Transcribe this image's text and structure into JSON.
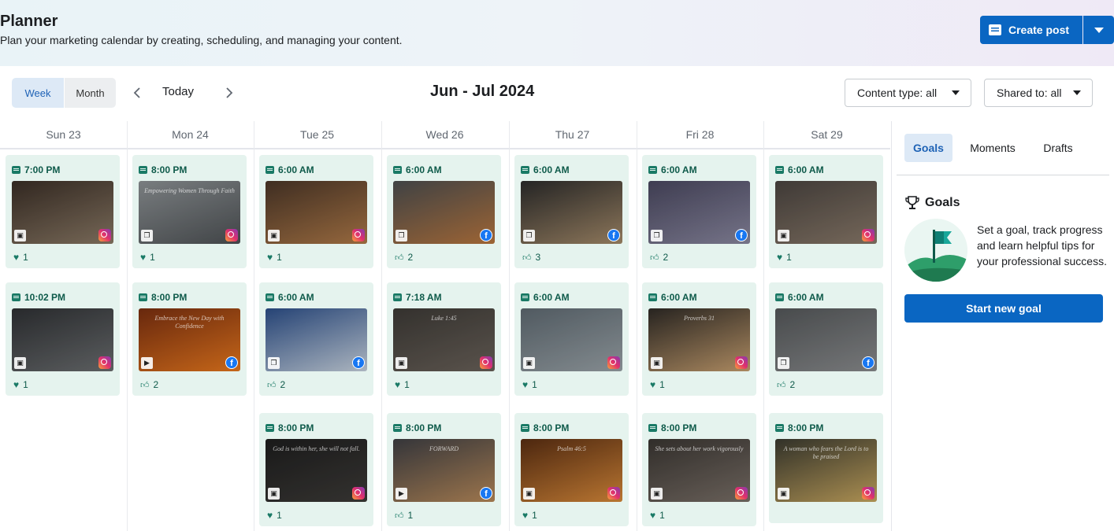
{
  "header": {
    "title": "Planner",
    "subtitle": "Plan your marketing calendar by creating, scheduling, and managing your content.",
    "create_label": "Create post"
  },
  "toolbar": {
    "week_label": "Week",
    "month_label": "Month",
    "today_label": "Today",
    "range": "Jun - Jul 2024",
    "content_filter": "Content type: all",
    "shared_filter": "Shared to: all"
  },
  "days": [
    {
      "label": "Sun 23",
      "posts": [
        {
          "time": "7:00 PM",
          "type": "image",
          "network": "instagram",
          "reaction": "heart",
          "count": "1",
          "caption": "",
          "colors": [
            "#3a2e26",
            "#8b7a66"
          ]
        },
        {
          "time": "10:02 PM",
          "type": "image",
          "network": "instagram",
          "reaction": "heart",
          "count": "1",
          "caption": "",
          "colors": [
            "#2f3134",
            "#6b6e70"
          ]
        }
      ]
    },
    {
      "label": "Mon 24",
      "posts": [
        {
          "time": "8:00 PM",
          "type": "carousel",
          "network": "instagram",
          "reaction": "heart",
          "count": "1",
          "caption": "Empowering Women Through Faith",
          "colors": [
            "#8e9396",
            "#4d5154"
          ]
        },
        {
          "time": "8:00 PM",
          "type": "video",
          "network": "facebook",
          "reaction": "like",
          "count": "2",
          "caption": "Embrace the New Day with Confidence",
          "colors": [
            "#7a2f10",
            "#e8781e"
          ]
        }
      ]
    },
    {
      "label": "Tue 25",
      "posts": [
        {
          "time": "6:00 AM",
          "type": "image",
          "network": "instagram",
          "reaction": "heart",
          "count": "1",
          "caption": "",
          "colors": [
            "#4a3628",
            "#b07a48"
          ]
        },
        {
          "time": "6:00 AM",
          "type": "carousel",
          "network": "facebook",
          "reaction": "like",
          "count": "2",
          "caption": "",
          "colors": [
            "#2c4f8a",
            "#c9d4e0"
          ]
        },
        {
          "time": "8:00 PM",
          "type": "image",
          "network": "instagram",
          "reaction": "heart",
          "count": "1",
          "caption": "God is within her, she will not fall.",
          "colors": [
            "#1e1e1e",
            "#3d3b38"
          ]
        }
      ]
    },
    {
      "label": "Wed 26",
      "posts": [
        {
          "time": "6:00 AM",
          "type": "carousel",
          "network": "facebook",
          "reaction": "like",
          "count": "2",
          "caption": "",
          "colors": [
            "#4b4e50",
            "#b8763e"
          ]
        },
        {
          "time": "7:18 AM",
          "type": "image",
          "network": "instagram",
          "reaction": "heart",
          "count": "1",
          "caption": "Luke 1:45",
          "colors": [
            "#3d3a36",
            "#6a625a"
          ]
        },
        {
          "time": "8:00 PM",
          "type": "video",
          "network": "facebook",
          "reaction": "like",
          "count": "1",
          "caption": "FORWARD",
          "colors": [
            "#3e3f44",
            "#b88a5a"
          ]
        }
      ]
    },
    {
      "label": "Thu 27",
      "posts": [
        {
          "time": "6:00 AM",
          "type": "carousel",
          "network": "facebook",
          "reaction": "like",
          "count": "3",
          "caption": "",
          "colors": [
            "#2b2b2b",
            "#a58b6a"
          ]
        },
        {
          "time": "6:00 AM",
          "type": "image",
          "network": "instagram",
          "reaction": "heart",
          "count": "1",
          "caption": "",
          "colors": [
            "#5f6a72",
            "#9aa3a8"
          ]
        },
        {
          "time": "8:00 PM",
          "type": "image",
          "network": "instagram",
          "reaction": "heart",
          "count": "1",
          "caption": "Psalm 46:5",
          "colors": [
            "#5a2e12",
            "#d98a3a"
          ]
        }
      ]
    },
    {
      "label": "Fri 28",
      "posts": [
        {
          "time": "6:00 AM",
          "type": "carousel",
          "network": "facebook",
          "reaction": "like",
          "count": "2",
          "caption": "",
          "colors": [
            "#4a4860",
            "#8a88a0"
          ]
        },
        {
          "time": "6:00 AM",
          "type": "image",
          "network": "instagram",
          "reaction": "heart",
          "count": "1",
          "caption": "Proverbs 31",
          "colors": [
            "#2e2a26",
            "#c8a070"
          ]
        },
        {
          "time": "8:00 PM",
          "type": "image",
          "network": "instagram",
          "reaction": "heart",
          "count": "1",
          "caption": "She sets about her work vigorously",
          "colors": [
            "#3a3632",
            "#7a7068"
          ]
        }
      ]
    },
    {
      "label": "Sat 29",
      "posts": [
        {
          "time": "6:00 AM",
          "type": "image",
          "network": "instagram",
          "reaction": "heart",
          "count": "1",
          "caption": "",
          "colors": [
            "#4a4440",
            "#8a7a6a"
          ]
        },
        {
          "time": "6:00 AM",
          "type": "carousel",
          "network": "facebook",
          "reaction": "like",
          "count": "2",
          "caption": "",
          "colors": [
            "#55585a",
            "#8a8c8e"
          ]
        },
        {
          "time": "8:00 PM",
          "type": "image",
          "network": "instagram",
          "reaction": "",
          "count": "",
          "caption": "A woman who fears the Lord is to be praised",
          "colors": [
            "#3a3a30",
            "#c9a860"
          ]
        }
      ]
    }
  ],
  "sidebar": {
    "tabs": [
      "Goals",
      "Moments",
      "Drafts"
    ],
    "goals_title": "Goals",
    "goals_text": "Set a goal, track progress and learn helpful tips for your professional success.",
    "goal_button": "Start new goal"
  },
  "colors": {
    "accent": "#0a66c2",
    "card": "#e5f3ee",
    "card_text": "#0e5a4a"
  }
}
